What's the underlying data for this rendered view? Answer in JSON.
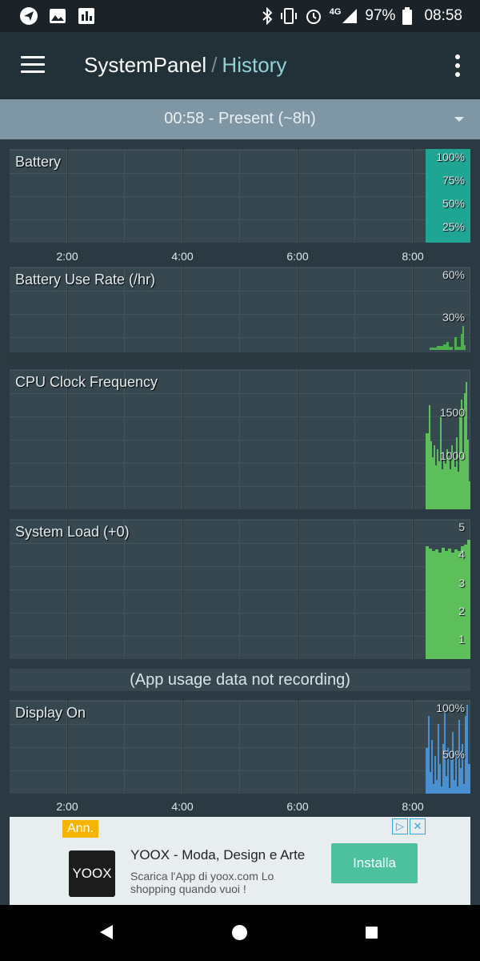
{
  "status_bar": {
    "battery": "97%",
    "time": "08:58",
    "network": "4G",
    "icons": [
      "send-icon",
      "image-icon",
      "stats-icon",
      "bluetooth-icon",
      "vibrate-icon",
      "alarm-icon",
      "signal-icon",
      "battery-icon"
    ]
  },
  "toolbar": {
    "app_name": "SystemPanel",
    "separator": "/",
    "section": "History"
  },
  "range": {
    "label": "00:58 - Present (~8h)"
  },
  "x_axis": [
    "2:00",
    "4:00",
    "6:00",
    "8:00"
  ],
  "charts": {
    "battery": {
      "title": "Battery",
      "ylabels": [
        "100%",
        "75%",
        "50%",
        "25%"
      ],
      "color": "#1fa593"
    },
    "use_rate": {
      "title": "Battery Use Rate (/hr)",
      "ylabels": [
        "60%",
        "30%"
      ],
      "color": "#4caf50"
    },
    "cpu": {
      "title": "CPU Clock Frequency",
      "ylabels": [
        "1500",
        "1000"
      ],
      "color": "#5cbf5a"
    },
    "load": {
      "title": "System Load (+0)",
      "ylabels": [
        "5",
        "4",
        "3",
        "2",
        "1"
      ],
      "color": "#5cbf5a"
    },
    "display": {
      "title": "Display On",
      "ylabels": [
        "100%",
        "50%"
      ],
      "color": "#4a8fd0"
    }
  },
  "notice": "(App usage data not recording)",
  "ad": {
    "badge": "Ann.",
    "logo_text": "YOOX",
    "title": "YOOX - Moda, Design e Arte",
    "description": "Scarica l'App di yoox.com Lo shopping quando vuoi !",
    "button": "Installa"
  }
}
